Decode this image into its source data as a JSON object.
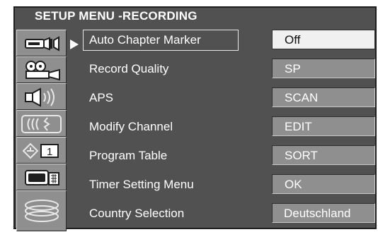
{
  "menu": {
    "title": "SETUP MENU -RECORDING"
  },
  "sidebar": {
    "items": [
      {
        "icon": "camcorder-icon",
        "selected": true
      },
      {
        "icon": "film-projector-icon"
      },
      {
        "icon": "speaker-icon"
      },
      {
        "icon": "radio-waves-icon"
      },
      {
        "icon": "clock-channel-icon",
        "badge": "1"
      },
      {
        "icon": "tv-monitor-icon"
      },
      {
        "icon": "disc-stack-icon"
      }
    ]
  },
  "settings": [
    {
      "label": "Auto Chapter Marker",
      "value": "Off",
      "selected": true
    },
    {
      "label": "Record Quality",
      "value": "SP"
    },
    {
      "label": "APS",
      "value": "SCAN"
    },
    {
      "label": "Modify Channel",
      "value": "EDIT"
    },
    {
      "label": "Program Table",
      "value": "SORT"
    },
    {
      "label": "Timer Setting Menu",
      "value": "OK"
    },
    {
      "label": "Country Selection",
      "value": "Deutschland"
    }
  ],
  "colors": {
    "panel": "#515151",
    "button": "#8f8f8f",
    "selected_value_bg": "#f0f0f0",
    "text": "#ffffff"
  }
}
